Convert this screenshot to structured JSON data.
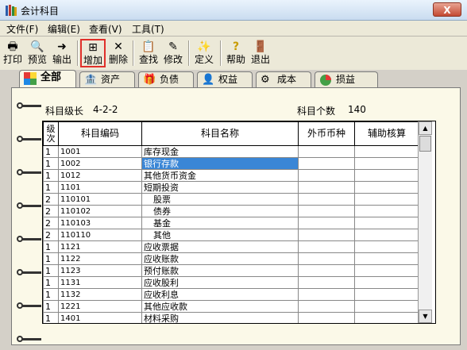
{
  "window": {
    "title": "会计科目",
    "close": "X"
  },
  "menu": [
    "文件(F)",
    "编辑(E)",
    "查看(V)",
    "工具(T)"
  ],
  "toolbar": {
    "print": "打印",
    "preview": "预览",
    "export": "输出",
    "add": "增加",
    "delete": "删除",
    "find": "查找",
    "modify": "修改",
    "define": "定义",
    "help": "帮助",
    "exit": "退出"
  },
  "tabs": [
    "全部",
    "资产",
    "负债",
    "权益",
    "成本",
    "损益"
  ],
  "info": {
    "level_label": "科目级长",
    "level_value": "4-2-2",
    "count_label": "科目个数",
    "count_value": "140"
  },
  "table": {
    "headers": [
      "级次",
      "科目编码",
      "科目名称",
      "外币币种",
      "辅助核算"
    ],
    "rows": [
      [
        "1",
        "1001",
        "库存现金"
      ],
      [
        "1",
        "1002",
        "银行存款"
      ],
      [
        "1",
        "1012",
        "其他货币资金"
      ],
      [
        "1",
        "1101",
        "短期投资"
      ],
      [
        "2",
        "110101",
        "股票"
      ],
      [
        "2",
        "110102",
        "债券"
      ],
      [
        "2",
        "110103",
        "基金"
      ],
      [
        "2",
        "110110",
        "其他"
      ],
      [
        "1",
        "1121",
        "应收票据"
      ],
      [
        "1",
        "1122",
        "应收账款"
      ],
      [
        "1",
        "1123",
        "预付账款"
      ],
      [
        "1",
        "1131",
        "应收股利"
      ],
      [
        "1",
        "1132",
        "应收利息"
      ],
      [
        "1",
        "1221",
        "其他应收款"
      ],
      [
        "1",
        "1401",
        "材料采购"
      ]
    ],
    "selected_row": 1
  }
}
